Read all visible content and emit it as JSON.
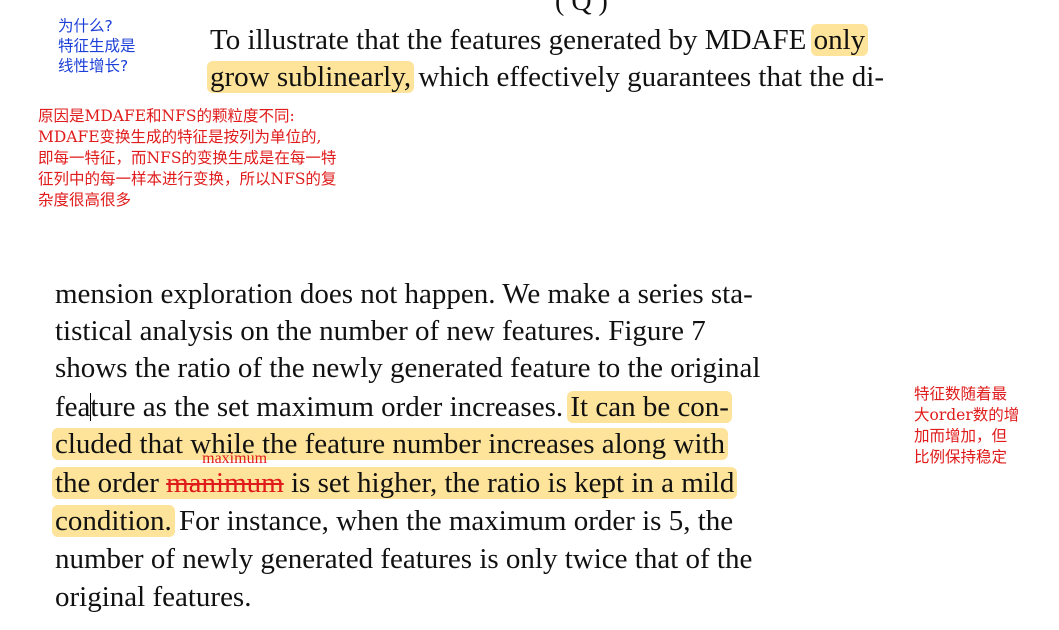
{
  "clipped_top_text": "( Q )",
  "annotations": {
    "blue_note": [
      "为什么?",
      "特征生成是",
      "线性增长?"
    ],
    "red_note": [
      "原因是MDAFE和NFS的颗粒度不同:",
      "MDAFE变换生成的特征是按列为单位的,",
      "即每一特征，而NFS的变换生成是在每一特",
      "征列中的每一样本进行变换，所以NFS的复",
      "杂度很高很多"
    ],
    "right_note": [
      "特征数随着最",
      "大order数的增",
      "加而增加，但",
      "比例保持稳定"
    ],
    "strike_correction": "maximum"
  },
  "colors": {
    "highlight": "#fde49a",
    "annotation_red": "#e01b1b",
    "annotation_blue": "#1b3fd8"
  },
  "paragraph1": {
    "line1_text": "To illustrate that the features generated by MDAFE ",
    "line1_hl": "only",
    "line2_hl": "grow sublinearly,",
    "line2_text": " which effectively guarantees that the di-"
  },
  "paragraph2": {
    "l1": "mension exploration does not happen. We make a series sta-",
    "l2": "tistical analysis on the number of new features. Figure 7",
    "l3": "shows the ratio of the newly generated feature to the original",
    "l4_a": "fea",
    "l4_b": "ture as the set maximum order increases.",
    "l4_hl": "It can be con-",
    "l5_hl": "cluded that while the feature number increases along with",
    "l6_hl_a": "the order ",
    "l6_strike": "manimum",
    "l6_hl_b": " is set higher, the ratio is kept in a mild",
    "l7_hl": "condition.",
    "l7_text": " For instance, when the maximum order is 5, the",
    "l8": "number of newly generated features is only twice that of the",
    "l9": "original features."
  }
}
